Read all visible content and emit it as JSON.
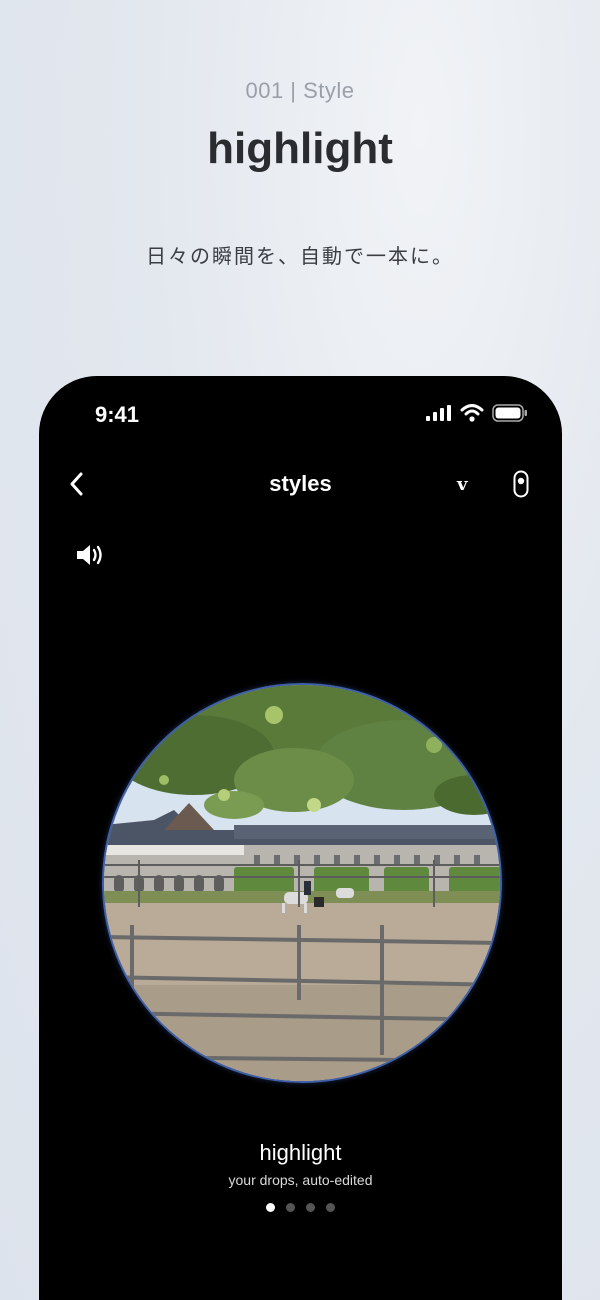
{
  "promo": {
    "label": "001 | Style",
    "title": "highlight",
    "tagline": "日々の瞬間を、自動で一本に。"
  },
  "status_bar": {
    "time": "9:41",
    "icons": [
      "signal-icon",
      "wifi-icon",
      "battery-icon"
    ]
  },
  "nav": {
    "back_icon": "chevron-left-icon",
    "title": "styles",
    "v_label": "v",
    "device_icon": "remote-device-icon"
  },
  "sound_icon": "speaker-icon",
  "style_card": {
    "name": "highlight",
    "description": "your drops, auto-edited"
  },
  "pager": {
    "total": 4,
    "active_index": 0
  },
  "colors": {
    "background": "#e3e8ef",
    "phone": "#000000",
    "circle_border": "#3f5fa8",
    "active_dot": "#ffffff",
    "inactive_dot": "#555555"
  }
}
